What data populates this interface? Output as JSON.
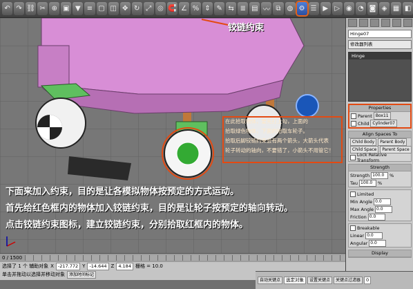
{
  "toolbar": {
    "icons": [
      "undo-icon",
      "redo-icon",
      "link-icon",
      "unlink-icon",
      "bind-icon",
      "select-icon",
      "filter-icon",
      "select-name-icon",
      "rect-select-icon",
      "window-icon",
      "move-icon",
      "rotate-icon",
      "scale-icon",
      "pivot-icon",
      "snap-icon",
      "angle-snap-icon",
      "percent-snap-icon",
      "spinner-snap-icon",
      "named-sel-icon",
      "mirror-icon",
      "align-icon",
      "layer-icon",
      "curve-icon",
      "schematic-icon",
      "material-icon",
      "hinge-constraint-icon",
      "render-setup-icon",
      "render-icon",
      "quick-render-icon",
      "teapot-icon",
      "kettle-icon",
      "camera-icon",
      "env-icon",
      "viewport-icon",
      "max-icon"
    ],
    "highlight_label": "铰链约束"
  },
  "annotation": {
    "line1": "在此拾取物体，要先打上勾，上面的",
    "line2": "拾取绿色物体，下面的拾取车轮子。",
    "line3": "拾取后脚铰链约束会有两个箭头，大箭头代表",
    "line4": "轮子转动的轴向，不要错了，小箭头不用管它！"
  },
  "captions": {
    "line1": "下面来加入约束，目的是让各模拟物体按预定的方式运动。",
    "line2": "首先给红色框内的物体加入铰链约束，目的是让轮子按预定的轴向转动。",
    "line3": "点击铰链约束图标，建立铰链约束，分别拾取红框内的物体。"
  },
  "panel": {
    "object_name": "Hinge07",
    "modifier_list": "修改器列表",
    "stack_item": "Hinge",
    "properties_title": "Properties",
    "parent_label": "Parent",
    "parent_value": "Box11",
    "child_label": "Child",
    "child_value": "Cylinder07",
    "align_spaces_title": "Align Spaces To",
    "child_body": "Child Body",
    "parent_body": "Parent Body",
    "child_space": "Child Space",
    "parent_space": "Parent Space",
    "lock_relative": "Lock Relative Transform",
    "strength_title": "Strength",
    "strength_label": "Strength",
    "strength_value": "100.0",
    "tau_label": "Tau",
    "tau_value": "100.0",
    "percent": "%",
    "limited_label": "Limited",
    "min_angle_label": "Min Angle",
    "min_angle_value": "0.0",
    "max_angle_label": "Max Angle",
    "max_angle_value": "0.0",
    "friction_label": "Friction",
    "friction_value": "0.0",
    "breakable_label": "Breakable",
    "linear_label": "Linear",
    "linear_value": "0.0",
    "angular_label": "Angular",
    "angular_value": "0.0",
    "display_title": "Display"
  },
  "status": {
    "time_range": "0 / 1500",
    "selected": "选择了 1 个 辅助对象",
    "x_label": "X",
    "x_value": "-217.772",
    "y_label": "Y",
    "y_value": "-14.644",
    "z_label": "Z",
    "z_value": "4.184",
    "grid": "栅格 = 10.0",
    "auto_key": "自动关键点",
    "selected_obj": "选定对象",
    "set_key": "设置关键点",
    "key_filter": "关键点过滤器",
    "hint": "单击并拖动以选择并移动对象",
    "add_time_tag": "添加时间标记",
    "frame_value": "0"
  },
  "colors": {
    "highlight_red": "#e34a12",
    "pink_body": "#d88ed6",
    "green_part": "#5fbf5f"
  }
}
